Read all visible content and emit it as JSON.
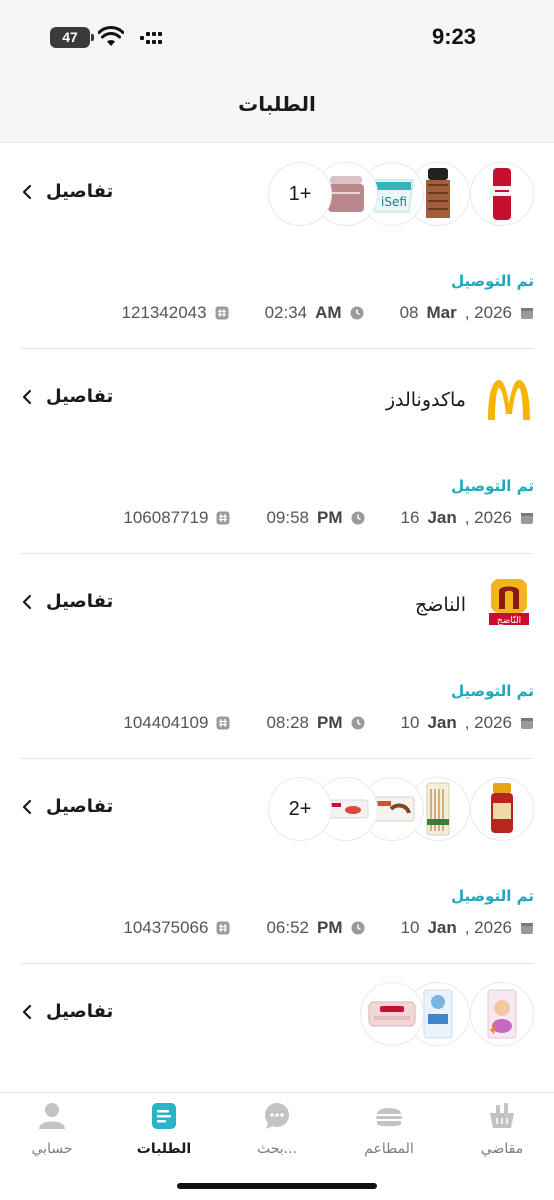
{
  "status_bar": {
    "time": "9:23",
    "battery": "47"
  },
  "header": {
    "title": "الطلبات"
  },
  "details_label": "تفاصيل",
  "orders": [
    {
      "extra_count": "1+",
      "status": "تم التوصيل",
      "date_day": "08",
      "date_month": "Mar",
      "date_year": ", 2026",
      "time": "02:34",
      "ampm": "AM",
      "order_no": "121342043"
    },
    {
      "merchant": "ماكدونالدز",
      "status": "تم التوصيل",
      "date_day": "16",
      "date_month": "Jan",
      "date_year": ", 2026",
      "time": "09:58",
      "ampm": "PM",
      "order_no": "106087719"
    },
    {
      "merchant": "الناضج",
      "logo_text": "النّاضج",
      "status": "تم التوصيل",
      "date_day": "10",
      "date_month": "Jan",
      "date_year": ", 2026",
      "time": "08:28",
      "ampm": "PM",
      "order_no": "104404109"
    },
    {
      "extra_count": "2+",
      "status": "تم التوصيل",
      "date_day": "10",
      "date_month": "Jan",
      "date_year": ", 2026",
      "time": "06:52",
      "ampm": "PM",
      "order_no": "104375066"
    },
    {}
  ],
  "nav": {
    "items": [
      {
        "label": "مقاضي",
        "icon": "basket-icon"
      },
      {
        "label": "المطاعم",
        "icon": "burger-icon"
      },
      {
        "label": "بحث...",
        "icon": "chat-search-icon"
      },
      {
        "label": "الطلبات",
        "icon": "orders-icon"
      },
      {
        "label": "حسابي",
        "icon": "account-icon"
      }
    ]
  },
  "colors": {
    "accent": "#1fa8c0",
    "active_nav": "#2bb3c8"
  }
}
